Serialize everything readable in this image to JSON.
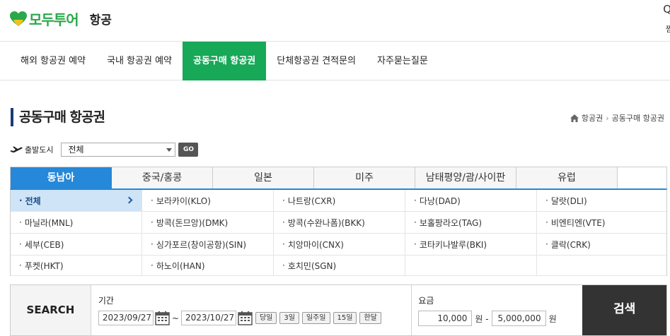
{
  "header": {
    "brand": "모두투어",
    "section": "항공",
    "right_top": "Q",
    "right_bottom": "찜"
  },
  "nav": [
    {
      "label": "해외 항공권 예약",
      "active": false
    },
    {
      "label": "국내 항공권 예약",
      "active": false
    },
    {
      "label": "공동구매 항공권",
      "active": true
    },
    {
      "label": "단체항공권 견적문의",
      "active": false
    },
    {
      "label": "자주묻는질문",
      "active": false
    }
  ],
  "page": {
    "title": "공동구매 항공권",
    "breadcrumb": [
      "항공권",
      "공동구매 항공권"
    ]
  },
  "departure": {
    "label": "출발도시",
    "selected": "전체",
    "go": "GO"
  },
  "region_tabs": [
    {
      "label": "동남아",
      "active": true
    },
    {
      "label": "중국/홍콩",
      "active": false
    },
    {
      "label": "일본",
      "active": false
    },
    {
      "label": "미주",
      "active": false
    },
    {
      "label": "남태평양/괌/사이판",
      "active": false
    },
    {
      "label": "유럽",
      "active": false
    }
  ],
  "cities": [
    {
      "label": "전체",
      "selected": true
    },
    {
      "label": "보라카이(KLO)"
    },
    {
      "label": "나트랑(CXR)"
    },
    {
      "label": "다낭(DAD)"
    },
    {
      "label": "달랏(DLI)"
    },
    {
      "label": "마닐라(MNL)"
    },
    {
      "label": "방콕(돈므앙)(DMK)"
    },
    {
      "label": "방콕(수완나폼)(BKK)"
    },
    {
      "label": "보홀팡라오(TAG)"
    },
    {
      "label": "비엔티엔(VTE)"
    },
    {
      "label": "세부(CEB)"
    },
    {
      "label": "싱가포르(창이공항)(SIN)"
    },
    {
      "label": "치앙마이(CNX)"
    },
    {
      "label": "코타키나발루(BKI)"
    },
    {
      "label": "클락(CRK)"
    },
    {
      "label": "푸켓(HKT)"
    },
    {
      "label": "하노이(HAN)"
    },
    {
      "label": "호치민(SGN)"
    },
    {
      "label": ""
    },
    {
      "label": ""
    }
  ],
  "search": {
    "label": "SEARCH",
    "period_title": "기간",
    "date_from": "2023/09/27",
    "date_to": "2023/10/27",
    "tilde": "~",
    "quick": [
      "당일",
      "3일",
      "일주일",
      "15일",
      "한달"
    ],
    "fare_title": "요금",
    "fare_min": "10,000",
    "fare_max": "5,000,000",
    "won": "원",
    "won_dash": "원 -",
    "submit": "검색"
  }
}
